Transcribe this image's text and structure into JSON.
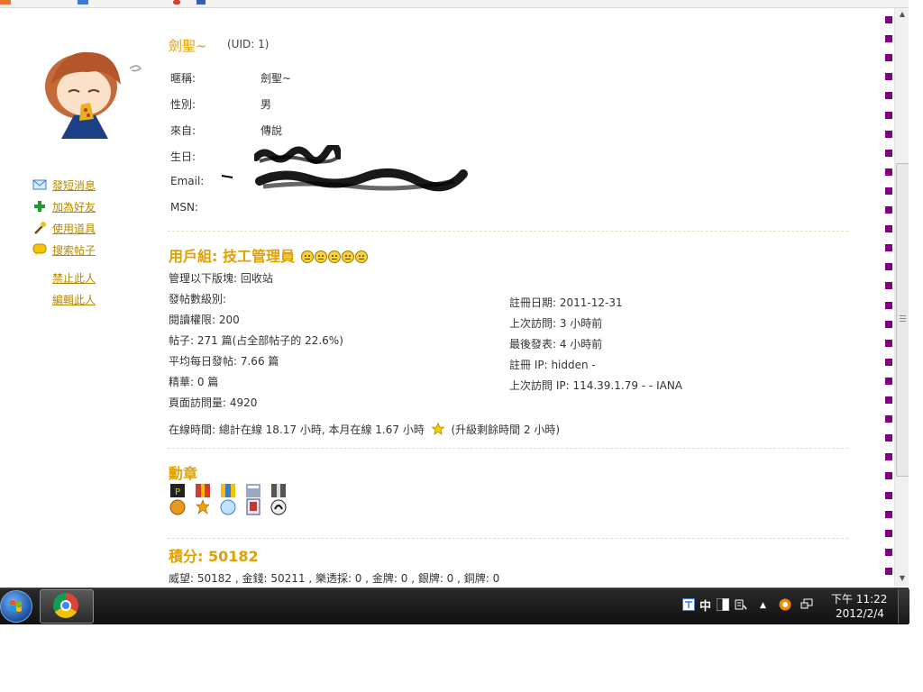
{
  "profile": {
    "username": "劍聖~",
    "uid": "(UID: 1)",
    "fields": [
      {
        "label": "暱稱:",
        "value": "劍聖~"
      },
      {
        "label": "性別:",
        "value": "男"
      },
      {
        "label": "來自:",
        "value": "傳說"
      },
      {
        "label": "生日:",
        "value": ""
      },
      {
        "label": "Email:",
        "value": ""
      },
      {
        "label": "MSN:",
        "value": ""
      }
    ]
  },
  "sidebar": {
    "actions": [
      {
        "label": "發短消息",
        "icon": "envelope-icon"
      },
      {
        "label": "加為好友",
        "icon": "plus-icon"
      },
      {
        "label": "使用道具",
        "icon": "wand-icon"
      },
      {
        "label": "搜索帖子",
        "icon": "chat-bubble-icon"
      }
    ],
    "ban_label": "禁止此人",
    "edit_label": "編輯此人"
  },
  "usergroup": {
    "title": "用戶組: 技工管理員",
    "left_stats": [
      "管理以下版塊: 回收站",
      "發帖數級別:",
      "閱讀權限: 200",
      "帖子: 271 篇(占全部帖子的 22.6%)",
      "平均每日發帖: 7.66 篇",
      "精華: 0 篇",
      "頁面訪問量: 4920"
    ],
    "right_stats": [
      "註冊日期: 2011-12-31",
      "上次訪問: 3 小時前",
      "最後發表: 4 小時前",
      "註冊 IP: hidden -",
      "上次訪問 IP: 114.39.1.79 - - IANA"
    ],
    "online_time": "在線時間: 總計在線 18.17 小時, 本月在線 1.67 小時",
    "upgrade": "(升級剩餘時間 2 小時)"
  },
  "medals": {
    "title": "勳章"
  },
  "points": {
    "title": "積分: 50182",
    "detail": "威望: 50182 , 金錢: 50211 , 樂透採: 0 , 金牌: 0 , 銀牌: 0 , 銅牌: 0"
  },
  "taskbar": {
    "ime": "中",
    "time": "下午 11:22",
    "date": "2012/2/4"
  },
  "colors": {
    "accent": "#e0a000",
    "link": "#b58a00",
    "dots": "#800080"
  }
}
